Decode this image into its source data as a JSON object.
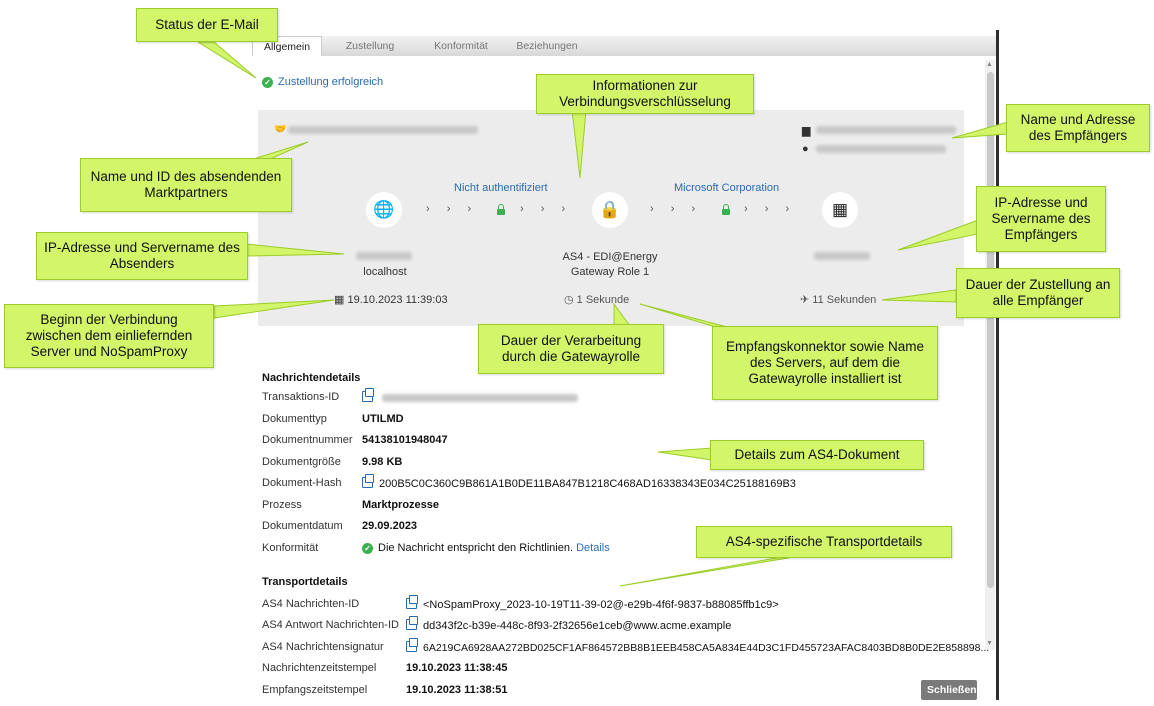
{
  "tabs": [
    {
      "label": "Allgemein",
      "active": true
    },
    {
      "label": "Zustellung",
      "active": false
    },
    {
      "label": "Konformität",
      "active": false
    },
    {
      "label": "Beziehungen",
      "active": false
    }
  ],
  "status": {
    "label": "Zustellung erfolgreich",
    "color": "#3cb050"
  },
  "connection": {
    "sender_hostname": "localhost",
    "auth_left": "Nicht authentifiziert",
    "auth_right": "Microsoft Corporation",
    "gateway_line1": "AS4 - EDI@Energy",
    "gateway_line2": "Gateway Role 1",
    "start_time": "19.10.2023 11:39:03",
    "processing_duration": "1 Sekunde",
    "delivery_duration": "11 Sekunden"
  },
  "message_details": {
    "title": "Nachrichtendetails",
    "rows": [
      {
        "label": "Transaktions-ID",
        "value": ""
      },
      {
        "label": "Dokumenttyp",
        "value": "UTILMD"
      },
      {
        "label": "Dokumentnummer",
        "value": "54138101948047"
      },
      {
        "label": "Dokumentgröße",
        "value": "9.98 KB"
      },
      {
        "label": "Dokument-Hash",
        "value": "200B5C0C360C9B861A1B0DE11BA847B1218C468AD16338343E034C25188169B3"
      },
      {
        "label": "Prozess",
        "value": "Marktprozesse"
      },
      {
        "label": "Dokumentdatum",
        "value": "29.09.2023"
      },
      {
        "label": "Konformität",
        "value": "Die Nachricht entspricht den Richtlinien.",
        "link": "Details"
      }
    ]
  },
  "transport_details": {
    "title": "Transportdetails",
    "rows": [
      {
        "label": "AS4 Nachrichten-ID",
        "value": "<NoSpamProxy_2023-10-19T11-39-02@-e29b-4f6f-9837-b88085ffb1c9>"
      },
      {
        "label": "AS4 Antwort Nachrichten-ID",
        "value": "dd343f2c-b39e-448c-8f93-2f32656e1ceb@www.acme.example"
      },
      {
        "label": "AS4 Nachrichtensignatur",
        "value": "6A219CA6928AA272BD025CF1AF864572BB8B1EEB458CA5A834E44D3C1FD455723AFAC8403BD8B0DE2E858898..."
      },
      {
        "label": "Nachrichtenzeitstempel",
        "value": "19.10.2023 11:38:45"
      },
      {
        "label": "Empfangszeitstempel",
        "value": "19.10.2023 11:38:51"
      }
    ]
  },
  "close_button": "Schließen",
  "callouts": {
    "status": "Status der E-Mail",
    "encryption": "Informationen zur Verbindungsverschlüsselung",
    "recipient_name": "Name und Adresse des Empfängers",
    "sender_partner": "Name und ID des absendenden Marktpartners",
    "recipient_ip": "IP-Adresse und Servername des Empfängers",
    "sender_ip": "IP-Adresse und Servername des Absenders",
    "delivery_duration": "Dauer der Zustellung an alle Empfänger",
    "connection_start": "Beginn der Verbindung zwischen dem einliefernden Server und NoSpamProxy",
    "processing_duration": "Dauer der Verarbeitung durch die Gatewayrolle",
    "receiving_connector": "Empfangskonnektor sowie Name des Servers, auf dem die Gatewayrolle installiert ist",
    "document_details": "Details zum AS4-Dokument",
    "transport_details": "AS4-spezifische Transportdetails"
  },
  "colors": {
    "callout": "#d2f56a",
    "link": "#2a6bb0",
    "panel": "#ececec"
  }
}
